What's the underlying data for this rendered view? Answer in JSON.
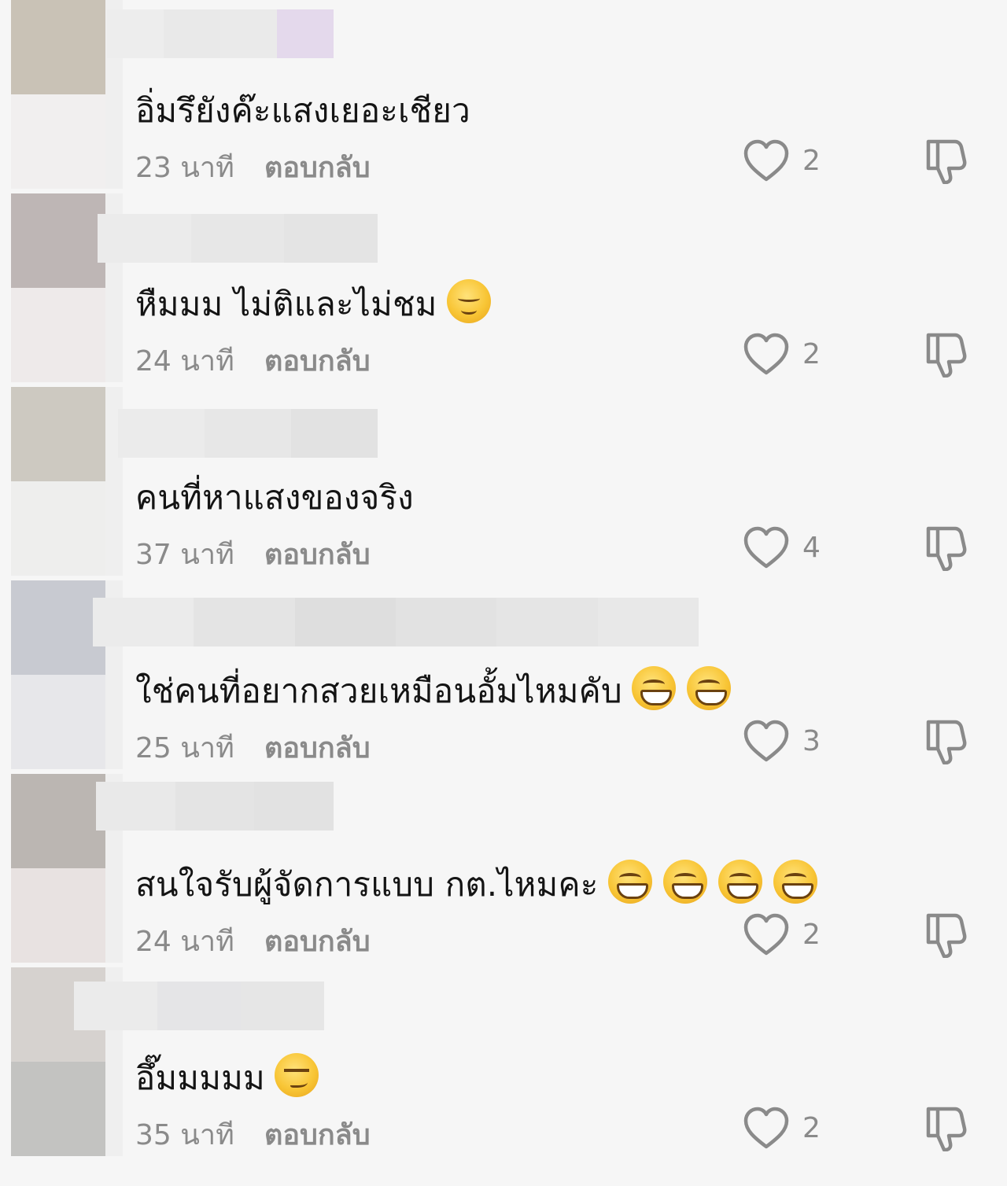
{
  "comments": [
    {
      "text": "อิ่มรึยังค๊ะแสงเยอะเชียว",
      "emojis": [],
      "time": "23 นาที",
      "reply_label": "ตอบกลับ",
      "likes": "2",
      "avatar_colors": [
        "#c9c2b6",
        "#f1efef"
      ],
      "name_blur_colors": [
        "#ededed",
        "#e9e9e9",
        "#eaeaea",
        "#e4d9ec"
      ]
    },
    {
      "text": "หืมมม ไม่ติและไม่ชม",
      "emojis": [
        "smiling-face-with-blush-emoji"
      ],
      "time": "24 นาที",
      "reply_label": "ตอบกลับ",
      "likes": "2",
      "avatar_colors": [
        "#beb6b5",
        "#eeeaea"
      ],
      "name_blur_colors": [
        "#ebebeb",
        "#e7e7e7",
        "#e4e4e4"
      ]
    },
    {
      "text": "คนที่หาแสงของจริง",
      "emojis": [],
      "time": "37 นาที",
      "reply_label": "ตอบกลับ",
      "likes": "4",
      "avatar_colors": [
        "#cdc9c1",
        "#eeeeed"
      ],
      "name_blur_colors": [
        "#ebebeb",
        "#e7e7e7",
        "#e2e2e2"
      ]
    },
    {
      "text": "ใช่คนที่อยากสวยเหมือนอั้มไหมคับ",
      "emojis": [
        "grinning-face-emoji",
        "grinning-face-emoji"
      ],
      "time": "25 นาที",
      "reply_label": "ตอบกลับ",
      "likes": "3",
      "avatar_colors": [
        "#c8cad1",
        "#e7e7ea"
      ],
      "name_blur_colors": [
        "#ebebeb",
        "#e4e4e4",
        "#dedede",
        "#e2e2e2",
        "#e5e5e5",
        "#e8e8e8"
      ]
    },
    {
      "text": "สนใจรับผู้จัดการแบบ กต.ไหมคะ",
      "emojis": [
        "grinning-face-emoji",
        "grinning-face-emoji",
        "grinning-face-emoji",
        "grinning-face-emoji"
      ],
      "time": "24 นาที",
      "reply_label": "ตอบกลับ",
      "likes": "2",
      "avatar_colors": [
        "#bbb6b2",
        "#e8e2e1"
      ],
      "name_blur_colors": [
        "#e9e9e9",
        "#e4e4e4",
        "#e2e2e2"
      ]
    },
    {
      "text": "อึ๊มมมมม",
      "emojis": [
        "smirking-face-emoji"
      ],
      "time": "35 นาที",
      "reply_label": "ตอบกลับ",
      "likes": "2",
      "avatar_colors": [
        "#d6d2cf",
        "#c3c3c1"
      ],
      "name_blur_colors": [
        "#ebebeb",
        "#e5e5e7",
        "#e6e6e6"
      ]
    }
  ]
}
